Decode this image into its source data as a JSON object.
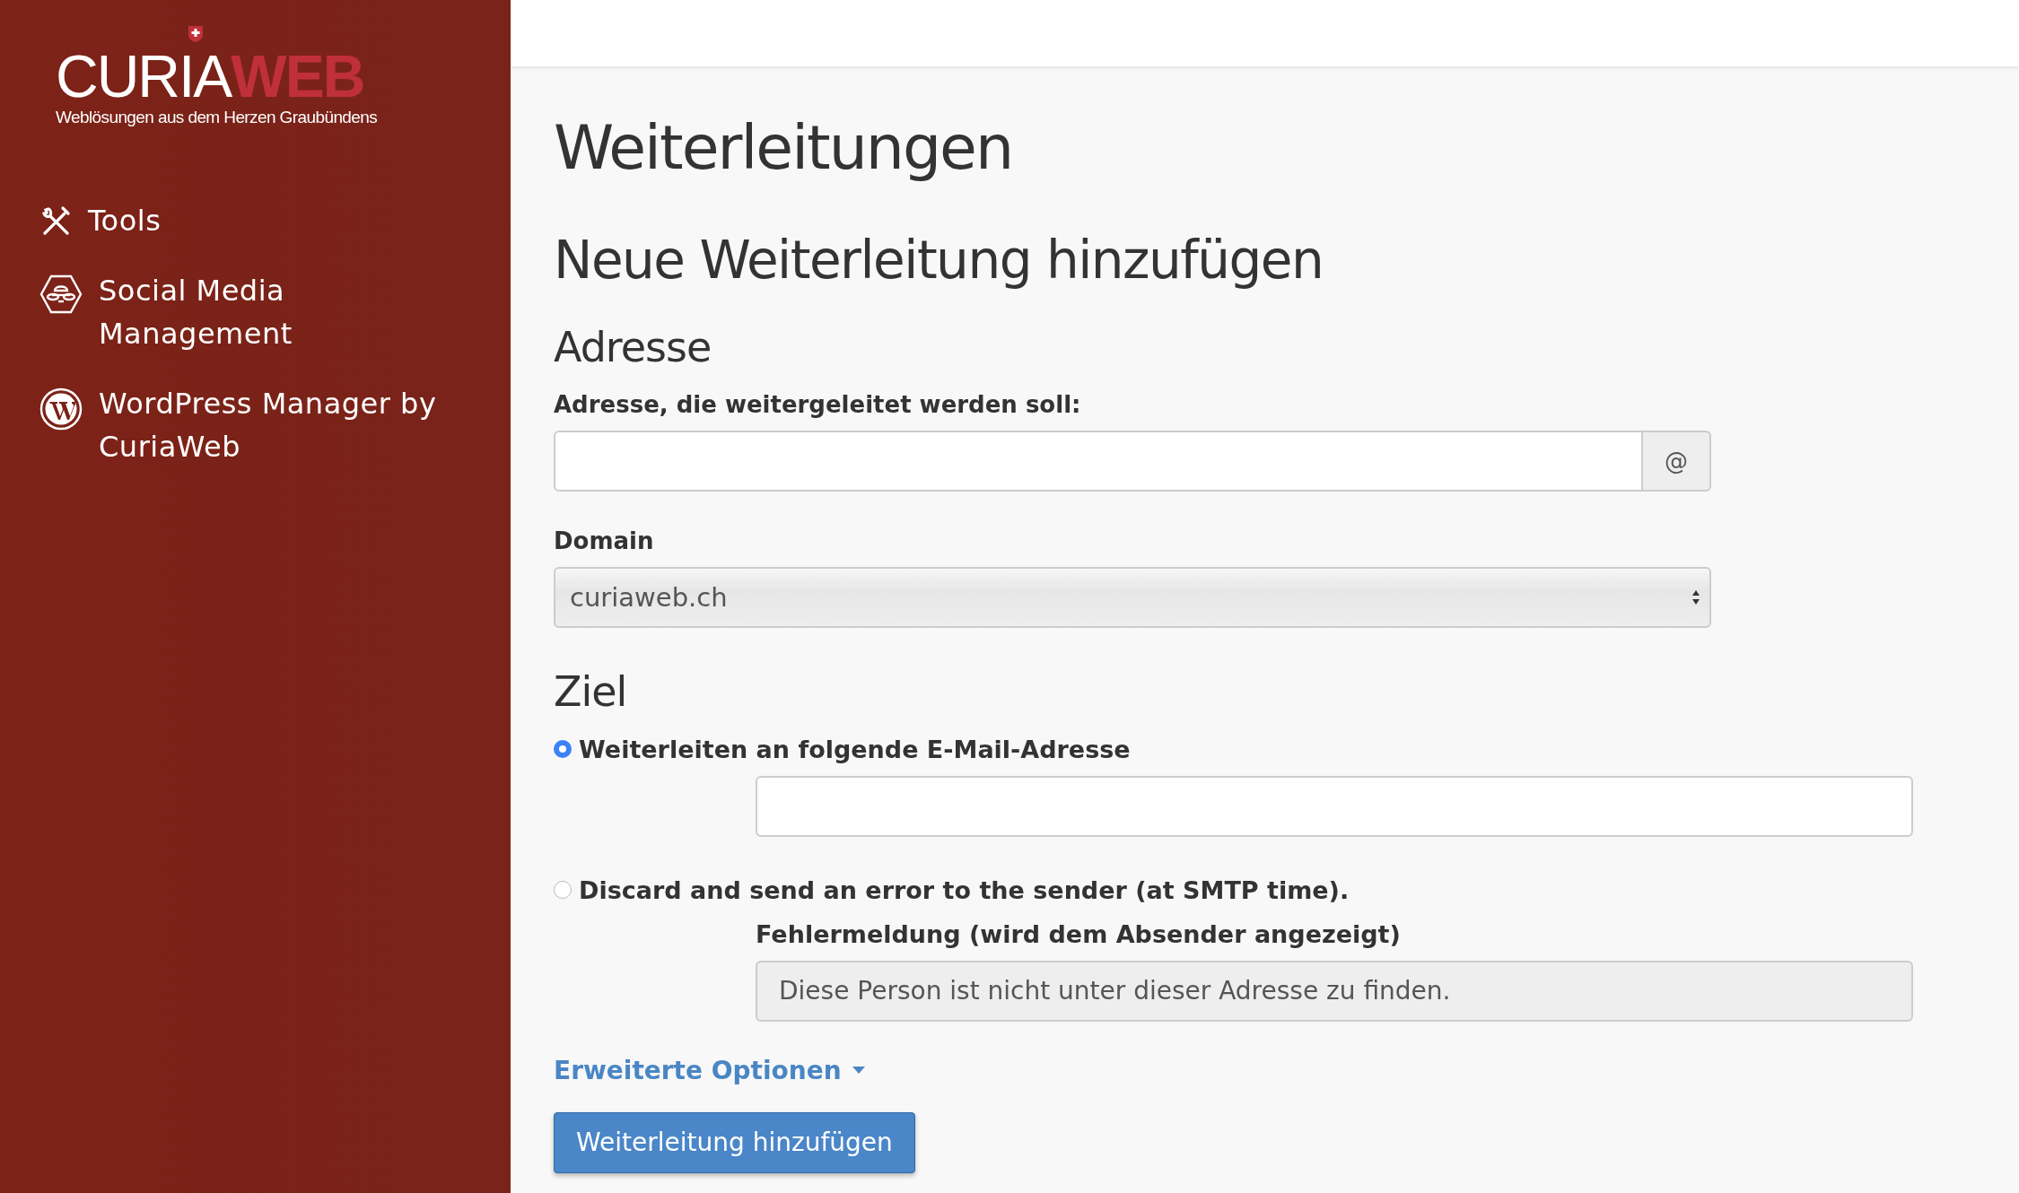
{
  "sidebar": {
    "logo": {
      "main": "CURIA",
      "accent": "WEB",
      "tagline": "Weblösungen aus dem Herzen Graubündens"
    },
    "items": [
      {
        "kind": "tools",
        "label": "Tools"
      },
      {
        "kind": "social",
        "label": "Social Media Management"
      },
      {
        "kind": "wordpress",
        "label": "WordPress Manager by CuriaWeb"
      }
    ]
  },
  "page_title": "Weiterleitungen",
  "form": {
    "title": "Neue Weiterleitung hinzufügen",
    "address_section": "Adresse",
    "address_label": "Adresse, die weitergeleitet werden soll:",
    "address_addon": "@",
    "domain_label": "Domain",
    "domain_value": "curiaweb.ch",
    "target_section": "Ziel",
    "options": [
      {
        "kind": "email",
        "label": "Weiterleiten an folgende E-Mail-Adresse",
        "selected": true
      },
      {
        "kind": "discard",
        "label": "Discard and send an error to the sender (at SMTP time).",
        "selected": false,
        "field_label": "Fehlermeldung (wird dem Absender angezeigt)",
        "field_value": "Diese Person ist nicht unter dieser Adresse zu finden."
      }
    ],
    "advanced_link": "Erweiterte Optionen",
    "submit": "Weiterleitung hinzufügen"
  }
}
